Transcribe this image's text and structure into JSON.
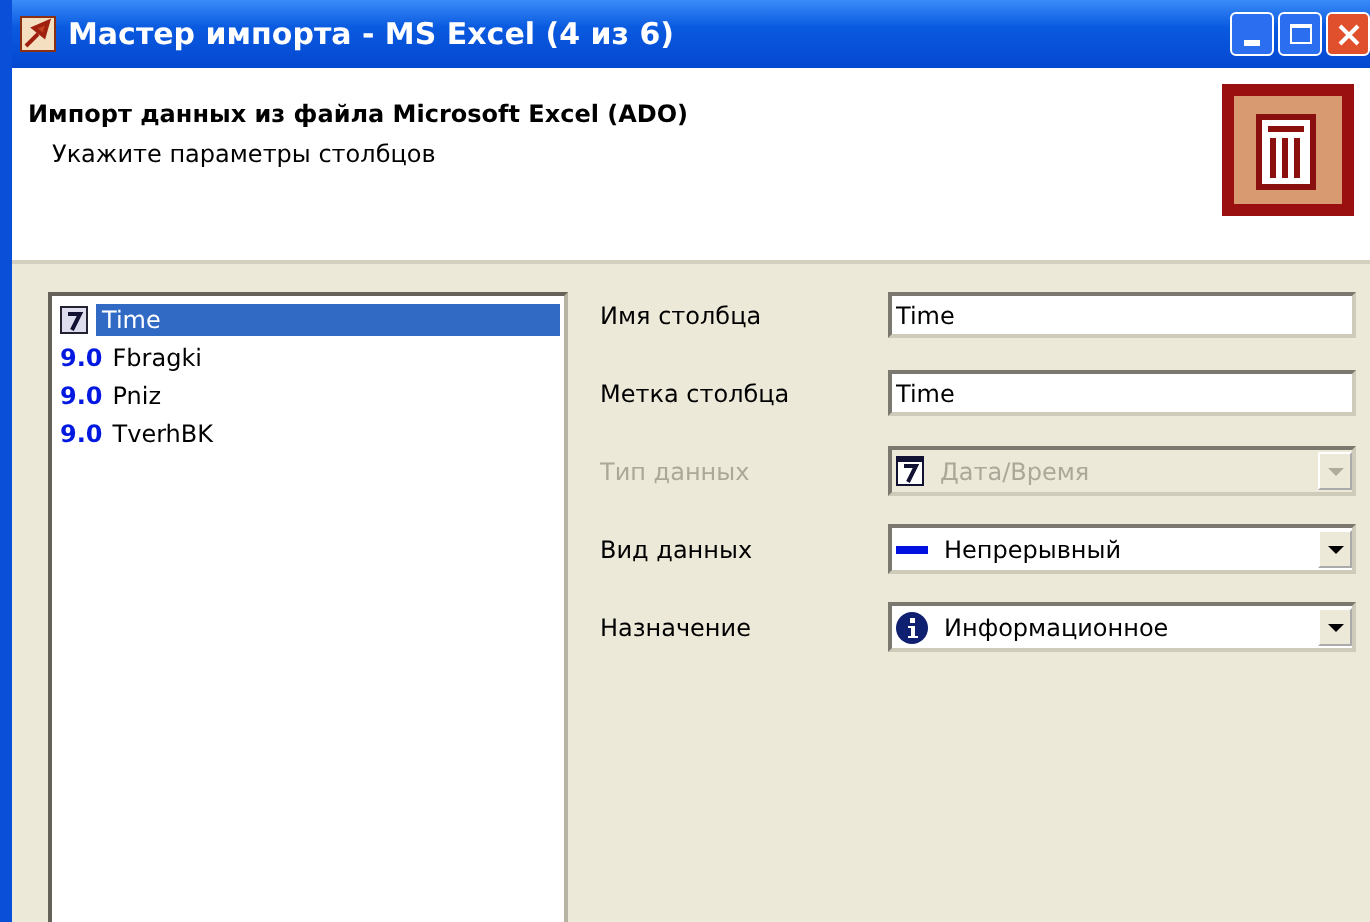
{
  "window": {
    "title": "Мастер импорта - MS Excel (4 из 6)"
  },
  "header": {
    "title": "Импорт данных из файла Microsoft Excel (ADO)",
    "subtitle": "Укажите параметры  столбцов"
  },
  "columns": [
    {
      "kind": "date",
      "name": "Time",
      "selected": true
    },
    {
      "kind": "numeric",
      "badge": "9.0",
      "name": "Fbragki",
      "selected": false
    },
    {
      "kind": "numeric",
      "badge": "9.0",
      "name": "Pniz",
      "selected": false
    },
    {
      "kind": "numeric",
      "badge": "9.0",
      "name": "TverhBK",
      "selected": false
    }
  ],
  "fields": [
    {
      "kind": "text",
      "label": "Имя столбца",
      "value": "Time",
      "disabled": false
    },
    {
      "kind": "text",
      "label": "Метка столбца",
      "value": "Time",
      "disabled": false
    },
    {
      "kind": "combo",
      "label": "Тип данных",
      "value": "Дата/Время",
      "disabled": true
    },
    {
      "kind": "combo",
      "label": "Вид данных",
      "value": "Непрерывный",
      "disabled": false
    },
    {
      "kind": "combo",
      "label": "Назначение",
      "value": "Информационное",
      "disabled": false
    }
  ]
}
